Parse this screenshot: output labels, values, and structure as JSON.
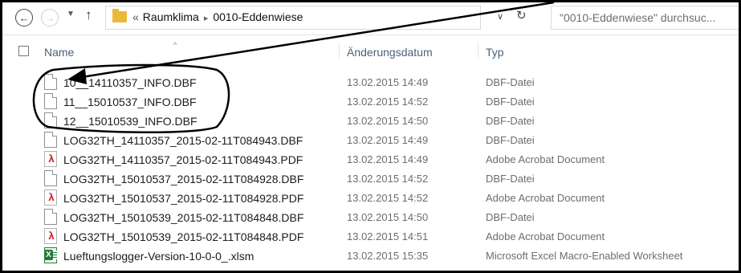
{
  "address_bar": {
    "back_icon": "arrow-left-icon",
    "forward_icon": "arrow-right-icon",
    "up_icon": "arrow-up-icon",
    "overflow_marker": "«",
    "breadcrumb": [
      "Raumklima",
      "0010-Eddenwiese"
    ],
    "breadcrumb_separator": "▸",
    "search_placeholder": "\"0010-Eddenwiese\" durchsuc..."
  },
  "columns": {
    "name": "Name",
    "date": "Änderungsdatum",
    "type": "Typ"
  },
  "files": [
    {
      "name": "10__14110357_INFO.DBF",
      "date": "13.02.2015 14:49",
      "type": "DBF-Datei",
      "icon": "dbf-file-icon"
    },
    {
      "name": "11__15010537_INFO.DBF",
      "date": "13.02.2015 14:52",
      "type": "DBF-Datei",
      "icon": "dbf-file-icon"
    },
    {
      "name": "12__15010539_INFO.DBF",
      "date": "13.02.2015 14:50",
      "type": "DBF-Datei",
      "icon": "dbf-file-icon"
    },
    {
      "name": "LOG32TH_14110357_2015-02-11T084943.DBF",
      "date": "13.02.2015 14:49",
      "type": "DBF-Datei",
      "icon": "dbf-file-icon"
    },
    {
      "name": "LOG32TH_14110357_2015-02-11T084943.PDF",
      "date": "13.02.2015 14:49",
      "type": "Adobe Acrobat Document",
      "icon": "pdf-file-icon"
    },
    {
      "name": "LOG32TH_15010537_2015-02-11T084928.DBF",
      "date": "13.02.2015 14:52",
      "type": "DBF-Datei",
      "icon": "dbf-file-icon"
    },
    {
      "name": "LOG32TH_15010537_2015-02-11T084928.PDF",
      "date": "13.02.2015 14:52",
      "type": "Adobe Acrobat Document",
      "icon": "pdf-file-icon"
    },
    {
      "name": "LOG32TH_15010539_2015-02-11T084848.DBF",
      "date": "13.02.2015 14:50",
      "type": "DBF-Datei",
      "icon": "dbf-file-icon"
    },
    {
      "name": "LOG32TH_15010539_2015-02-11T084848.PDF",
      "date": "13.02.2015 14:51",
      "type": "Adobe Acrobat Document",
      "icon": "pdf-file-icon"
    },
    {
      "name": "Lueftungslogger-Version-10-0-0_.xlsm",
      "date": "13.02.2015 15:35",
      "type": "Microsoft Excel Macro-Enabled Worksheet",
      "icon": "excel-file-icon"
    }
  ],
  "colors": {
    "header_text": "#4c607a",
    "secondary_text": "#6d6d6d",
    "folder": "#e9b93a",
    "pdf_red": "#c8161d",
    "excel_green": "#1f7a3a",
    "annotation": "#000000"
  }
}
